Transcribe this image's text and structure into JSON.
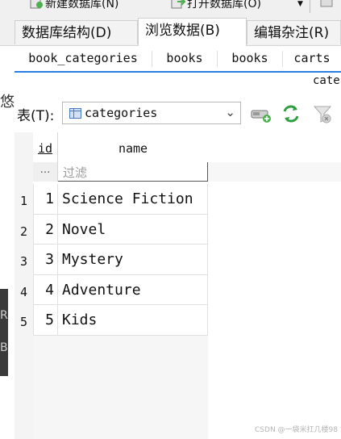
{
  "toolbar": {
    "new_db_label": "新建数据库(N)",
    "open_db_label": "打开数据库(O)"
  },
  "main_tabs": [
    {
      "label": "数据库结构(D)",
      "active": false
    },
    {
      "label": "浏览数据(B)",
      "active": true
    },
    {
      "label": "编辑杂注(R)",
      "active": false
    }
  ],
  "sub_tabs": [
    "book_categories",
    "books",
    "books",
    "carts"
  ],
  "sub_title": "cate",
  "table_select": {
    "label": "表(T):",
    "value": "categories"
  },
  "grid": {
    "columns": [
      "id",
      "name"
    ],
    "filter_placeholder": "过滤",
    "filter_dots": "…",
    "rows": [
      {
        "num": "1",
        "id": "1",
        "name": "Science Fiction"
      },
      {
        "num": "2",
        "id": "2",
        "name": "Novel"
      },
      {
        "num": "3",
        "id": "3",
        "name": "Mystery"
      },
      {
        "num": "4",
        "id": "4",
        "name": "Adventure"
      },
      {
        "num": "5",
        "id": "5",
        "name": "Kids"
      }
    ]
  },
  "edge": {
    "frag_top": "悠",
    "frag_r": "R",
    "frag_b": "B"
  },
  "watermark": "CSDN @一袋米扛几楼98",
  "colors": {
    "accent": "#2a7de1",
    "tab_bg": "#f0f0f0"
  }
}
